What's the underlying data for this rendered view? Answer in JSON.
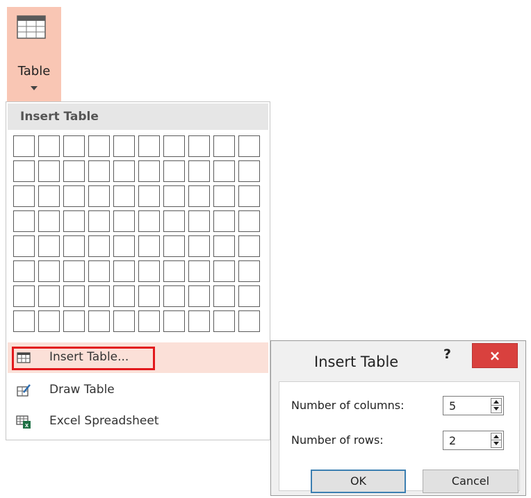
{
  "ribbon": {
    "table_button_label": "Table"
  },
  "dropdown": {
    "header": "Insert Table",
    "grid": {
      "columns": 10,
      "rows": 8
    },
    "items": [
      {
        "label": "Insert Table...",
        "icon": "table-icon",
        "highlighted": true
      },
      {
        "label": "Draw Table",
        "icon": "draw-table-icon",
        "highlighted": false
      },
      {
        "label": "Excel Spreadsheet",
        "icon": "excel-spreadsheet-icon",
        "highlighted": false
      }
    ]
  },
  "dialog": {
    "title": "Insert Table",
    "help": "?",
    "close": "×",
    "columns_label": "Number of columns:",
    "columns_value": "5",
    "rows_label": "Number of rows:",
    "rows_value": "2",
    "ok_label": "OK",
    "cancel_label": "Cancel"
  },
  "colors": {
    "ribbon_highlight": "#f9c6b4",
    "menu_highlight": "#fbe0d8",
    "callout_red": "#e2191d",
    "close_button": "#d9413e",
    "ok_border": "#3c7fb1"
  }
}
